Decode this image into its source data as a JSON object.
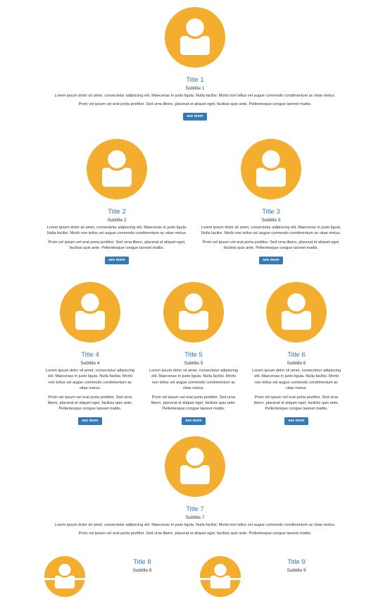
{
  "colors": {
    "avatar_bg": "#f3ad2f",
    "title": "#337ab7",
    "button": "#337ab7"
  },
  "icon": "user-icon",
  "items": [
    {
      "title": "Title 1",
      "subtitle": "Subtitle 1",
      "text1": "Lorem ipsum dolor sit amet, consectetur adipiscing elit. Maecenas in justo ligula. Nulla facilisi. Morbi non tellus vel augue commodo condimentum ac vitae metus.",
      "text2": "Proin vel ipsum vel erat porta porttitor. Sed urna libero, placerat et aliquet eget, facilisis quis ante. Pellentesque congue laoreet mattis.",
      "button": "see more"
    },
    {
      "title": "Title 2",
      "subtitle": "Subtitle 2",
      "text1": "Lorem ipsum dolor sit amet, consectetur adipiscing elit. Maecenas in justo ligula. Nulla facilisi. Morbi non tellus vel augue commodo condimentum ac vitae metus.",
      "text2": "Proin vel ipsum vel erat porta porttitor. Sed urna libero, placerat et aliquet eget, facilisis quis ante. Pellentesque congue laoreet mattis.",
      "button": "see more"
    },
    {
      "title": "Title 3",
      "subtitle": "Subtitle 3",
      "text1": "Lorem ipsum dolor sit amet, consectetur adipiscing elit. Maecenas in justo ligula. Nulla facilisi. Morbi non tellus vel augue commodo condimentum ac vitae metus.",
      "text2": "Proin vel ipsum vel erat porta porttitor. Sed urna libero, placerat et aliquet eget, facilisis quis ante. Pellentesque congue laoreet mattis.",
      "button": "see more"
    },
    {
      "title": "Title 4",
      "subtitle": "Subtitle 4",
      "text1": "Lorem ipsum dolor sit amet, consectetur adipiscing elit. Maecenas in justo ligula. Nulla facilisi. Morbi non tellus vel augue commodo condimentum ac vitae metus.",
      "text2": "Proin vel ipsum vel erat porta porttitor. Sed urna libero, placerat et aliquet eget, facilisis quis ante. Pellentesque congue laoreet mattis.",
      "button": "see more"
    },
    {
      "title": "Title 5",
      "subtitle": "Subtitle 5",
      "text1": "Lorem ipsum dolor sit amet, consectetur adipiscing elit. Maecenas in justo ligula. Nulla facilisi. Morbi non tellus vel augue commodo condimentum ac vitae metus.",
      "text2": "Proin vel ipsum vel erat porta porttitor. Sed urna libero, placerat et aliquet eget, facilisis quis ante. Pellentesque congue laoreet mattis.",
      "button": "see more"
    },
    {
      "title": "Title 6",
      "subtitle": "Subtitle 6",
      "text1": "Lorem ipsum dolor sit amet, consectetur adipiscing elit. Maecenas in justo ligula. Nulla facilisi. Morbi non tellus vel augue commodo condimentum ac vitae metus.",
      "text2": "Proin vel ipsum vel erat porta porttitor. Sed urna libero, placerat et aliquet eget, facilisis quis ante. Pellentesque congue laoreet mattis.",
      "button": "see more"
    },
    {
      "title": "Title 7",
      "subtitle": "Subtitle 7",
      "text1": "Lorem ipsum dolor sit amet, consectetur adipiscing elit. Maecenas in justo ligula. Nulla facilisi. Morbi non tellus vel augue commodo condimentum ac vitae metus.",
      "text2": "Proin vel ipsum vel erat porta porttitor. Sed urna libero, placerat et aliquet eget, facilisis quis ante. Pellentesque congue laoreet mattis.",
      "button": "see more"
    },
    {
      "title": "Title 8",
      "subtitle": "Subtitle 8",
      "text1": "",
      "text2": "",
      "button": ""
    },
    {
      "title": "Title 9",
      "subtitle": "Subtitle 9",
      "text1": "",
      "text2": "",
      "button": ""
    }
  ]
}
